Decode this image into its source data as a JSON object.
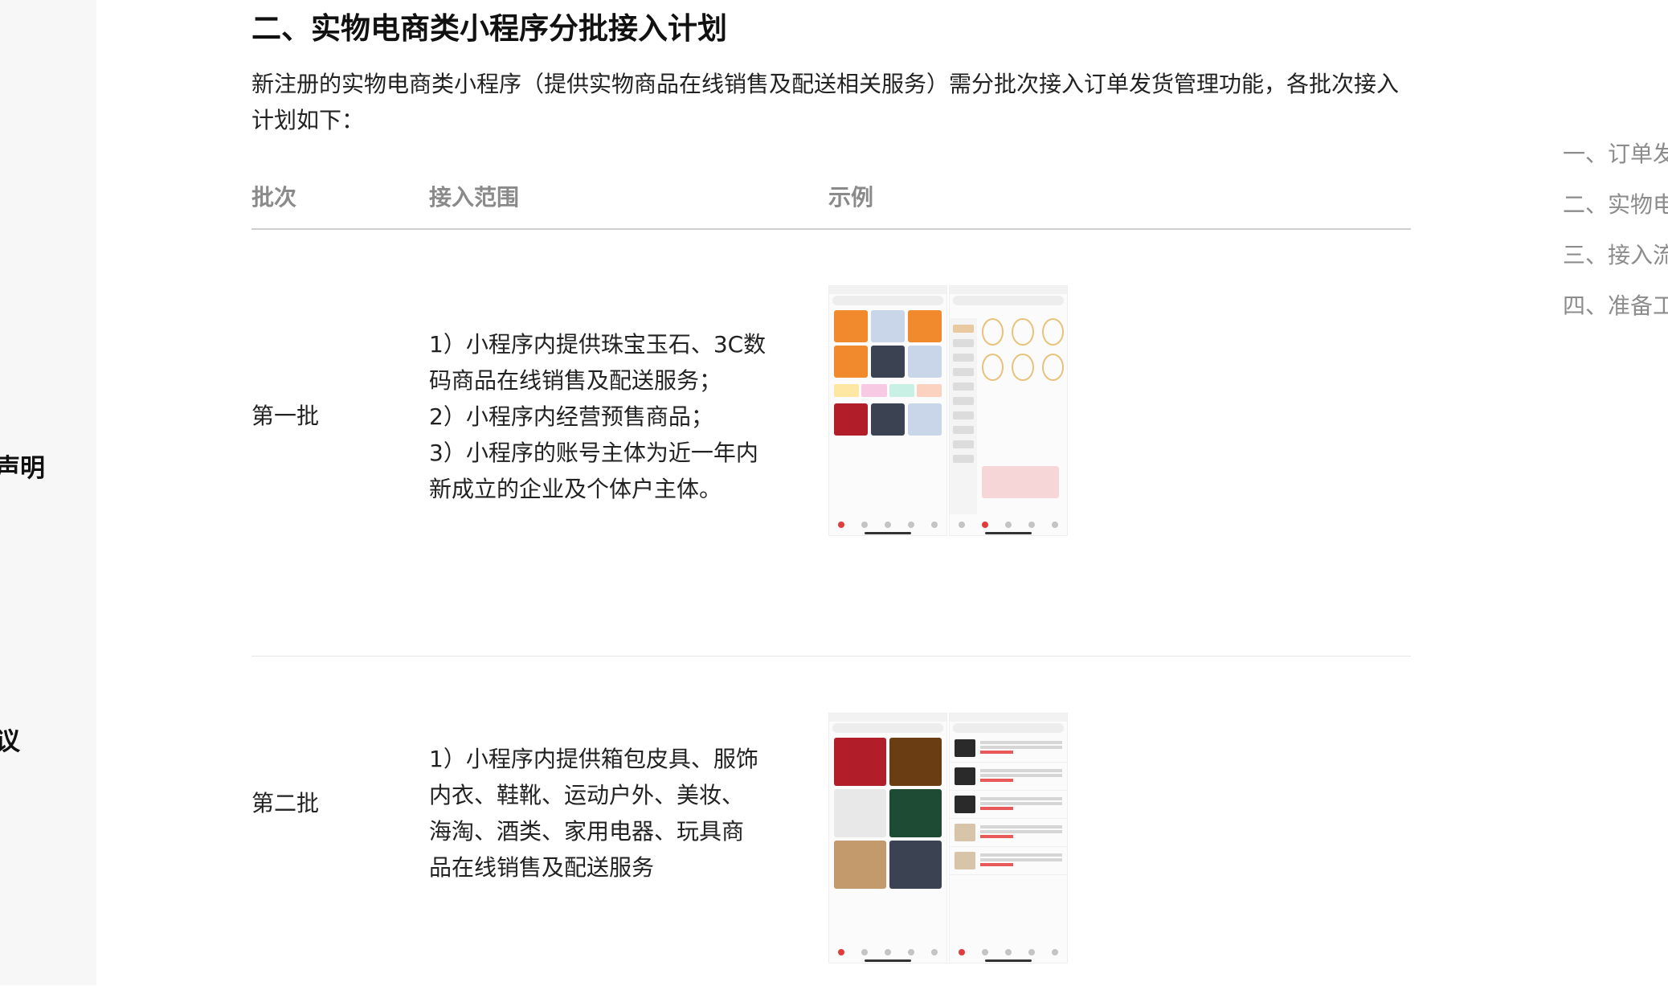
{
  "left_sidebar": {
    "fragment_1": "声明",
    "fragment_2": "议"
  },
  "section": {
    "title": "二、实物电商类小程序分批接入计划",
    "intro": "新注册的实物电商类小程序（提供实物商品在线销售及配送相关服务）需分批次接入订单发货管理功能，各批次接入计划如下："
  },
  "table": {
    "headers": {
      "batch": "批次",
      "scope": "接入范围",
      "example": "示例"
    },
    "rows": [
      {
        "batch": "第一批",
        "scope_lines": [
          "1）小程序内提供珠宝玉石、3C数",
          "码商品在线销售及配送服务；",
          "2）小程序内经营预售商品；",
          "3）小程序的账号主体为近一年内",
          "新成立的企业及个体户主体。"
        ]
      },
      {
        "batch": "第二批",
        "scope_lines": [
          "1）小程序内提供箱包皮具、服饰",
          "内衣、鞋靴、运动户外、美妆、",
          "海淘、酒类、家用电器、玩具商",
          "品在线销售及配送服务"
        ]
      }
    ]
  },
  "toc": {
    "items": [
      "一、订单发",
      "二、实物电",
      "三、接入流",
      "四、准备工"
    ]
  },
  "icons": {
    "phone_screenshot": "app-screenshot-image"
  }
}
